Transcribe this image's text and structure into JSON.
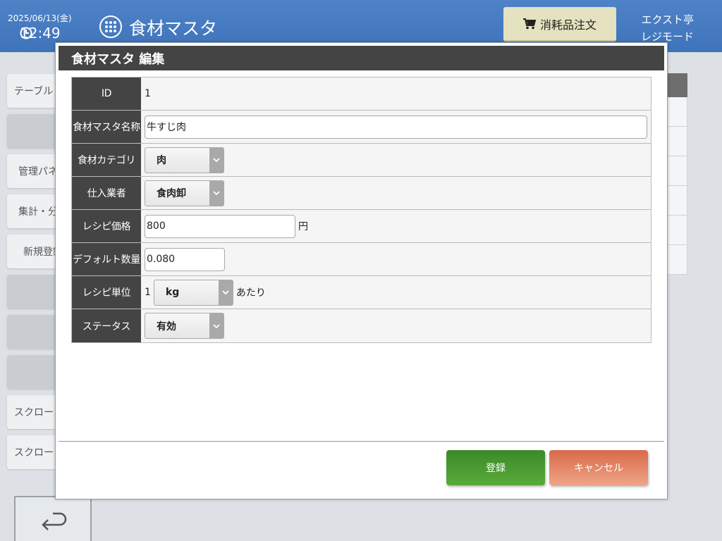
{
  "header": {
    "date": "2025/06/13(金)",
    "time": "12:49",
    "title": "食材マスタ",
    "order_button": "消耗品注文",
    "store_name": "エクスト亭",
    "mode": "レジモード"
  },
  "sidebar": {
    "items": [
      {
        "label": "テーブル"
      },
      {
        "label": ""
      },
      {
        "label": "管理パネ"
      },
      {
        "label": "集計・分"
      },
      {
        "label": "新規登録"
      },
      {
        "label": ""
      },
      {
        "label": ""
      },
      {
        "label": ""
      },
      {
        "label": "スクロー"
      },
      {
        "label": "スクロー"
      }
    ]
  },
  "modal": {
    "title": "食材マスタ 編集",
    "fields": {
      "id": {
        "label": "ID",
        "value": "1"
      },
      "name": {
        "label": "食材マスタ名称",
        "value": "牛すじ肉"
      },
      "category": {
        "label": "食材カテゴリ",
        "value": "肉"
      },
      "supplier": {
        "label": "仕入業者",
        "value": "食肉卸"
      },
      "price": {
        "label": "レシピ価格",
        "value": "800",
        "unit": "円"
      },
      "default_qty": {
        "label": "デフォルト数量",
        "value": "0.080"
      },
      "unit": {
        "label": "レシピ単位",
        "prefix": "1",
        "value": "kg",
        "suffix": "あたり"
      },
      "status": {
        "label": "ステータス",
        "value": "有効"
      }
    },
    "register_button": "登録",
    "cancel_button": "キャンセル"
  },
  "colors": {
    "header_bg": "#4a7ec4",
    "register": "#4a9a32",
    "cancel": "#e08a68"
  }
}
